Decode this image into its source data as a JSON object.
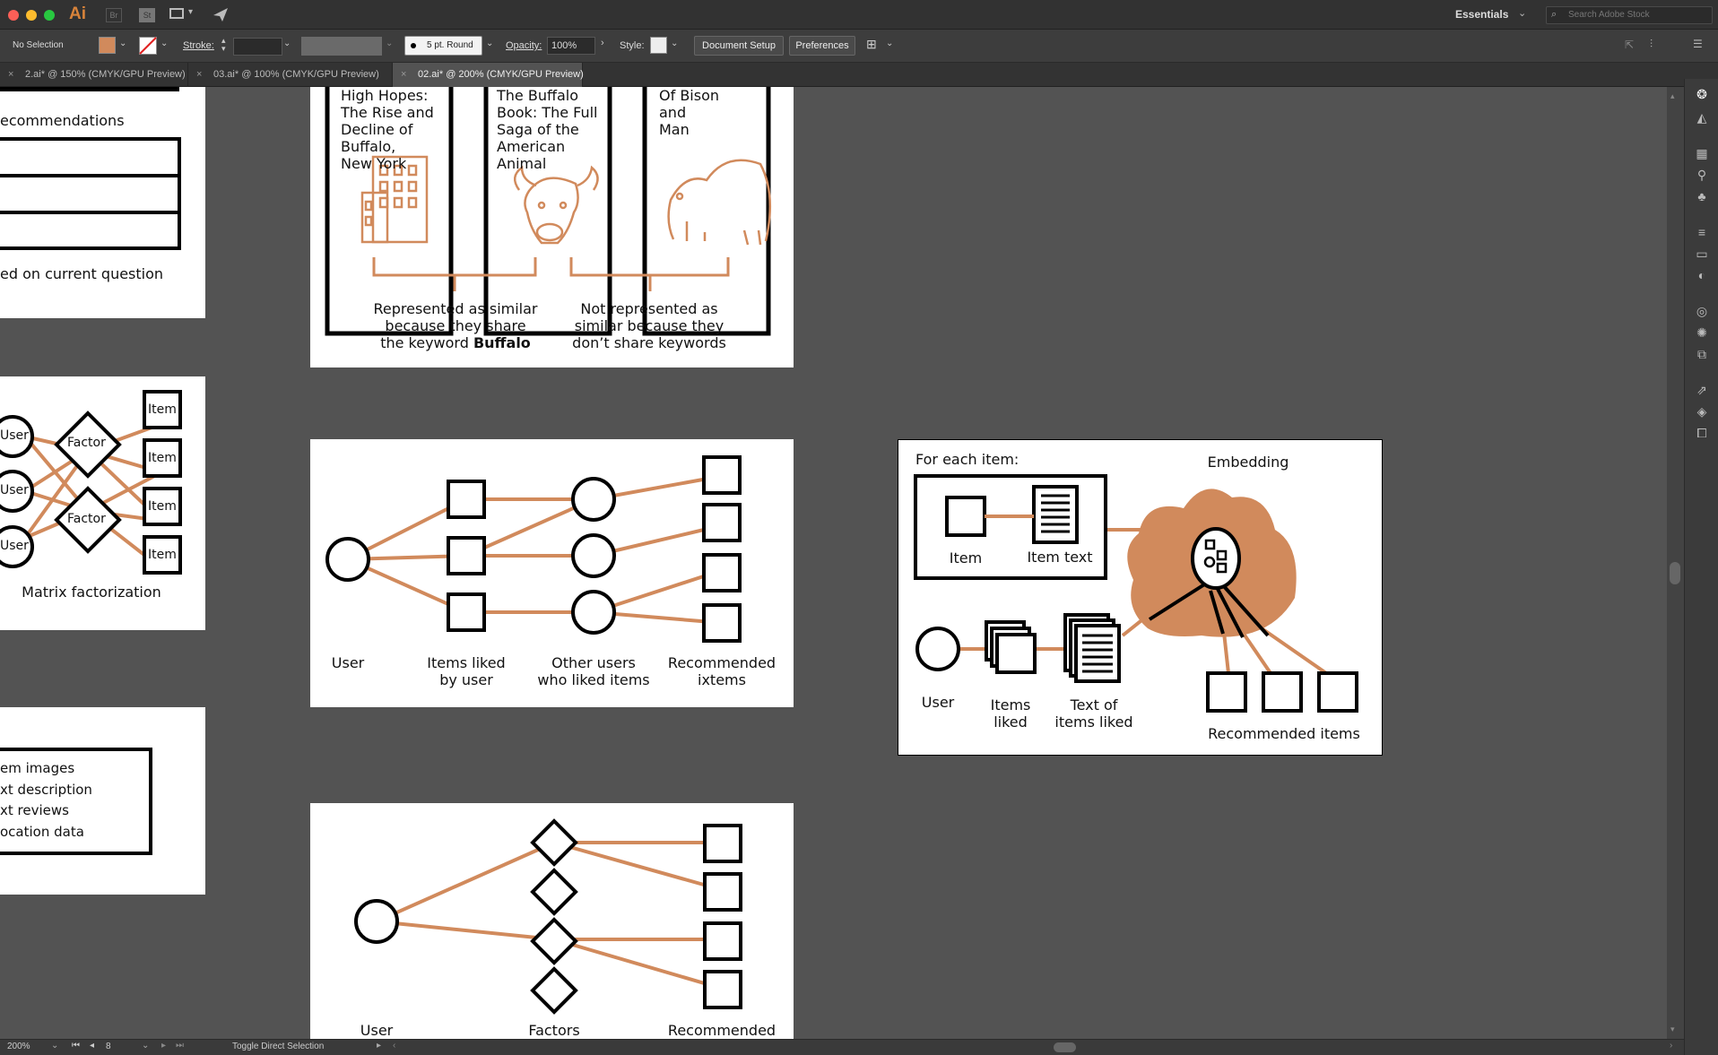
{
  "app": {
    "logo": "Ai",
    "workspace": "Essentials",
    "search_placeholder": "Search Adobe Stock",
    "badge_br": "Br",
    "badge_st": "St"
  },
  "control": {
    "selection": "No Selection",
    "stroke_label": "Stroke:",
    "brush": "5 pt. Round",
    "opacity_label": "Opacity:",
    "opacity_value": "100%",
    "style_label": "Style:",
    "document_setup": "Document Setup",
    "preferences": "Preferences",
    "fill_color": "#d18a5c"
  },
  "tabs": [
    {
      "label": "2.ai* @ 150% (CMYK/GPU Preview)"
    },
    {
      "label": "03.ai* @ 100% (CMYK/GPU Preview)"
    },
    {
      "label": "02.ai* @ 200% (CMYK/GPU Preview)"
    }
  ],
  "status": {
    "zoom": "200%",
    "page": "8",
    "tool": "Toggle Direct Selection"
  },
  "colors": {
    "accent": "#d18a5c",
    "canvas": "#535353"
  },
  "art": {
    "left1": {
      "title": "ecommendations",
      "caption": "ed on current question"
    },
    "left2": {
      "user": "User",
      "factor": "Factor",
      "item": "Item",
      "caption": "Matrix factorization"
    },
    "left3": {
      "lines": [
        "em images",
        "xt description",
        "xt reviews",
        "ocation data"
      ]
    },
    "books": {
      "book1": [
        "High Hopes:",
        "The Rise and",
        "Decline of",
        "Buffalo,",
        "New York"
      ],
      "book2": [
        "The Buffalo",
        "Book: The Full",
        "Saga of the",
        "American",
        "Animal"
      ],
      "book3": [
        "Of Bison",
        "and",
        "Man"
      ],
      "similar": [
        "Represented as similar",
        "because they share",
        "the keyword "
      ],
      "similar_bold": "Buffalo",
      "notsimilar": [
        "Not represented as",
        "similar because they",
        "don’t share keywords"
      ]
    },
    "collab": {
      "user": "User",
      "items_liked": [
        "Items liked",
        "by user"
      ],
      "other_users": [
        "Other users",
        "who liked items"
      ],
      "recommended": [
        "Recommended",
        "ixtems"
      ]
    },
    "factors": {
      "user": "User",
      "factors": "Factors",
      "recommended": "Recommended"
    },
    "embedding": {
      "for_each": "For each item:",
      "embedding": "Embedding",
      "item": "Item",
      "item_text": "Item text",
      "user": "User",
      "items_liked": [
        "Items",
        "liked"
      ],
      "text_liked": [
        "Text of",
        "items liked"
      ],
      "recommended": "Recommended items"
    }
  }
}
